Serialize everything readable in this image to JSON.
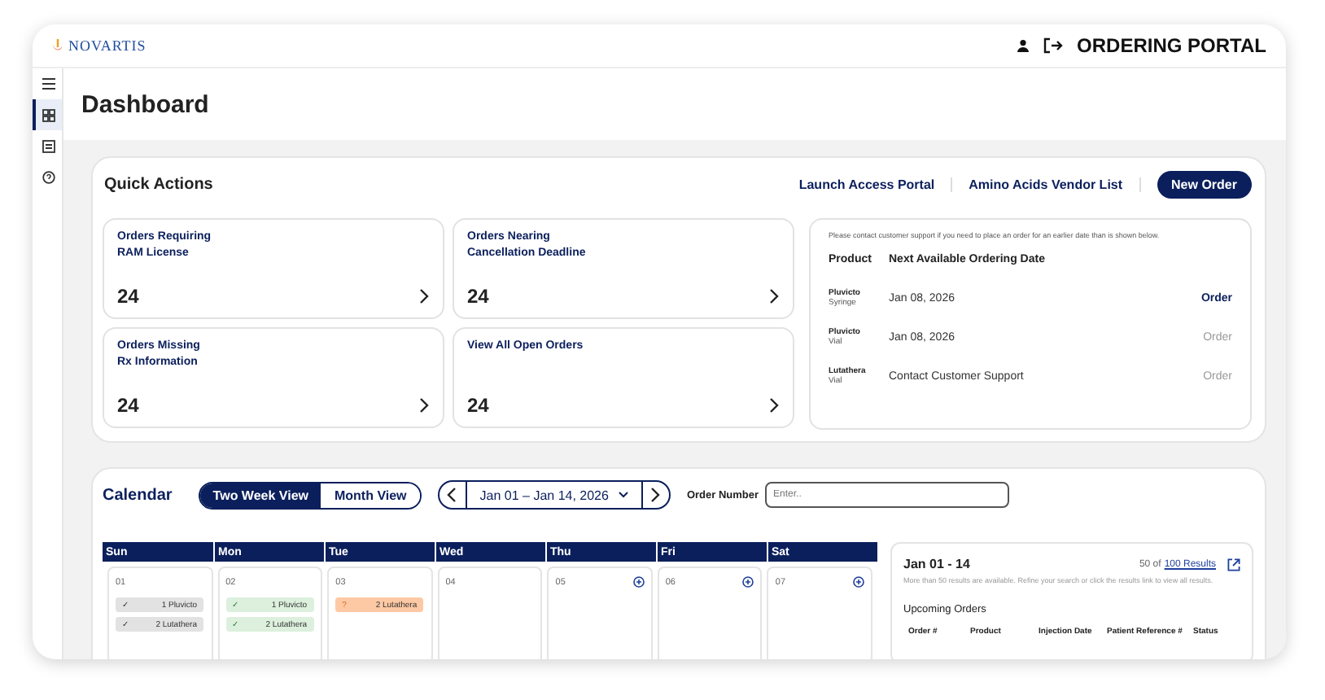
{
  "header": {
    "brand": "NOVARTIS",
    "portal_title": "ORDERING PORTAL"
  },
  "sidebar": {
    "items": [
      {
        "kind": "menu",
        "selected": false
      },
      {
        "kind": "grid",
        "selected": true
      },
      {
        "kind": "list",
        "selected": false
      },
      {
        "kind": "help",
        "selected": false
      }
    ]
  },
  "page_title": "Dashboard",
  "quick_actions": {
    "title": "Quick Actions",
    "links": [
      "Launch Access Portal",
      "Amino Acids Vendor List"
    ],
    "primary_button": "New Order",
    "tiles": [
      {
        "label": "Orders Requiring\nRAM License",
        "count": "24"
      },
      {
        "label": "Orders Nearing\nCancellation Deadline",
        "count": "24"
      },
      {
        "label": "Orders Missing\nRx Information",
        "count": "24"
      },
      {
        "label": "View All Open Orders",
        "count": "24"
      }
    ],
    "availability": {
      "note": "Please contact customer support if you need to place an order for an earlier date than is shown below.",
      "columns": [
        "Product",
        "Next Available Ordering Date"
      ],
      "rows": [
        {
          "product": "Pluvicto",
          "form": "Syringe",
          "date": "Jan 08, 2026",
          "action": "Order",
          "disabled": false
        },
        {
          "product": "Pluvicto",
          "form": "Vial",
          "date": "Jan 08, 2026",
          "action": "Order",
          "disabled": true
        },
        {
          "product": "Lutathera",
          "form": "Vial",
          "date": "Contact Customer Support",
          "action": "Order",
          "disabled": true
        }
      ]
    }
  },
  "calendar": {
    "title": "Calendar",
    "views": [
      {
        "label": "Two Week View",
        "selected": true
      },
      {
        "label": "Month View",
        "selected": false
      }
    ],
    "range": "Jan 01 – Jan 14, 2026",
    "order_number": {
      "label": "Order Number",
      "placeholder": "Enter.."
    },
    "weekdays": [
      "Sun",
      "Mon",
      "Tue",
      "Wed",
      "Thu",
      "Fri",
      "Sat"
    ],
    "days": [
      {
        "date": "01",
        "add": false,
        "entries": [
          {
            "kind": "done",
            "mark": "✓",
            "text": "1 Pluvicto",
            "color": "#e2e2e2"
          },
          {
            "kind": "done",
            "mark": "✓",
            "text": "2 Lutathera",
            "color": "#e2e2e2"
          }
        ]
      },
      {
        "date": "02",
        "add": false,
        "entries": [
          {
            "kind": "done",
            "mark": "✓",
            "text": "1 Pluvicto",
            "color": "#dcf0dd"
          },
          {
            "kind": "done",
            "mark": "✓",
            "text": "2 Lutathera",
            "color": "#dcf0dd"
          }
        ]
      },
      {
        "date": "03",
        "add": false,
        "entries": [
          {
            "kind": "pending",
            "mark": "?",
            "text": "2 Lutathera",
            "color": "#fdc9a4"
          }
        ]
      },
      {
        "date": "04",
        "add": false
      },
      {
        "date": "05",
        "add": true
      },
      {
        "date": "06",
        "add": true
      },
      {
        "date": "07",
        "add": true
      }
    ],
    "results": {
      "range": "Jan 01 - 14",
      "count_prefix": "50 of",
      "results_link": "100 Results",
      "note": "More than 50 results are available. Refine your search or click the results link to view all results.",
      "section": "Upcoming Orders",
      "columns": [
        "Order #",
        "Product",
        "Injection Date",
        "Patient Reference #",
        "Status"
      ]
    }
  }
}
